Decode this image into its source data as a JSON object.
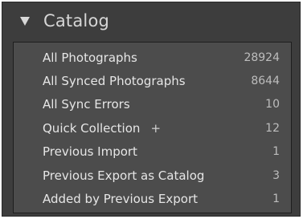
{
  "panel": {
    "title": "Catalog",
    "expanded": true,
    "icon": "triangle-down-icon"
  },
  "items": [
    {
      "label": "All Photographs",
      "count": "28924"
    },
    {
      "label": "All Synced Photographs",
      "count": "8644"
    },
    {
      "label": "All Sync Errors",
      "count": "10"
    },
    {
      "label": "Quick Collection",
      "marker": "+",
      "count": "12"
    },
    {
      "label": "Previous Import",
      "count": "1"
    },
    {
      "label": "Previous Export as Catalog",
      "count": "3"
    },
    {
      "label": "Added by Previous Export",
      "count": "1"
    }
  ]
}
